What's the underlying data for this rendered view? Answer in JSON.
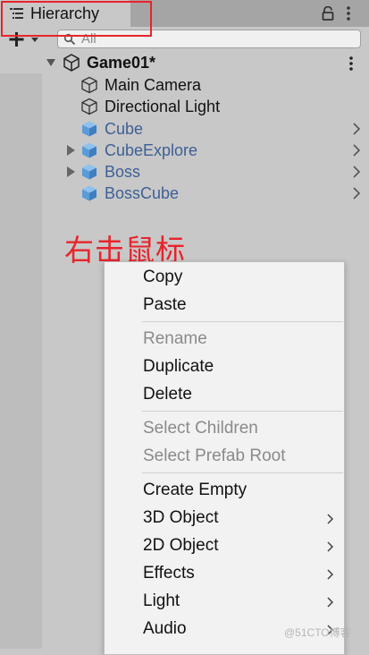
{
  "window": {
    "tab_title": "Hierarchy"
  },
  "toolbar": {
    "search_placeholder": "All"
  },
  "scene": {
    "name": "Game01*"
  },
  "hierarchy_items": [
    {
      "label": "Main Camera",
      "type": "gameobject",
      "has_children": false,
      "has_prefab_arrow": false
    },
    {
      "label": "Directional Light",
      "type": "gameobject",
      "has_children": false,
      "has_prefab_arrow": false
    },
    {
      "label": "Cube",
      "type": "prefab",
      "has_children": false,
      "has_prefab_arrow": true
    },
    {
      "label": "CubeExplore",
      "type": "prefab",
      "has_children": true,
      "has_prefab_arrow": true
    },
    {
      "label": "Boss",
      "type": "prefab",
      "has_children": true,
      "has_prefab_arrow": true
    },
    {
      "label": "BossCube",
      "type": "prefab",
      "has_children": false,
      "has_prefab_arrow": true
    }
  ],
  "annotation": "右击鼠标",
  "context_menu": {
    "items": [
      {
        "label": "Copy",
        "enabled": true,
        "submenu": false
      },
      {
        "label": "Paste",
        "enabled": true,
        "submenu": false
      },
      {
        "label": "Rename",
        "enabled": false,
        "submenu": false
      },
      {
        "label": "Duplicate",
        "enabled": true,
        "submenu": false
      },
      {
        "label": "Delete",
        "enabled": true,
        "submenu": false
      },
      {
        "label": "Select Children",
        "enabled": false,
        "submenu": false
      },
      {
        "label": "Select Prefab Root",
        "enabled": false,
        "submenu": false
      },
      {
        "label": "Create Empty",
        "enabled": true,
        "submenu": false
      },
      {
        "label": "3D Object",
        "enabled": true,
        "submenu": true
      },
      {
        "label": "2D Object",
        "enabled": true,
        "submenu": true
      },
      {
        "label": "Effects",
        "enabled": true,
        "submenu": true
      },
      {
        "label": "Light",
        "enabled": true,
        "submenu": true
      },
      {
        "label": "Audio",
        "enabled": true,
        "submenu": true
      }
    ]
  },
  "watermark": "@51CTO博客",
  "colors": {
    "highlight_box": "#e8242c",
    "prefab_text": "#3e5f96",
    "prefab_icon": "#5b9bd8",
    "disabled_text": "#8a8a8a",
    "annotation": "#e8242c"
  }
}
